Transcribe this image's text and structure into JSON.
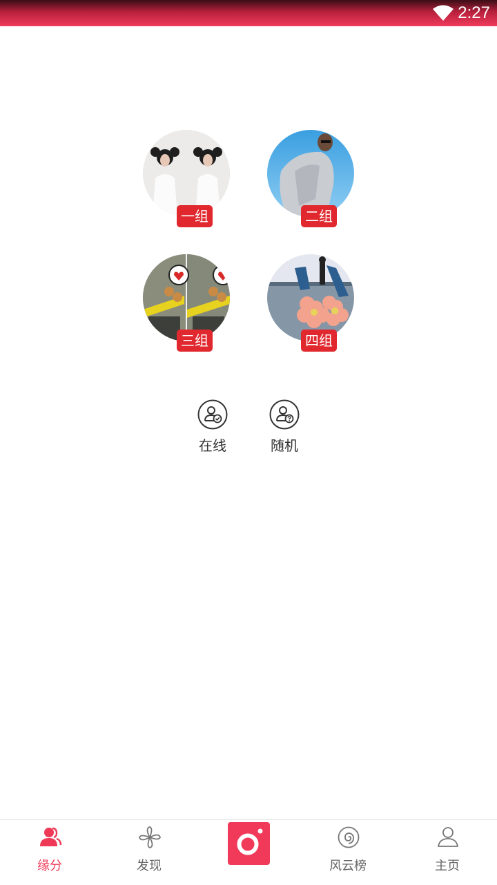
{
  "status_bar": {
    "time": "2:27"
  },
  "groups": [
    {
      "label": "一组"
    },
    {
      "label": "二组"
    },
    {
      "label": "三组"
    },
    {
      "label": "四组"
    }
  ],
  "actions": {
    "online": {
      "label": "在线",
      "icon": "user-check-icon"
    },
    "random": {
      "label": "随机",
      "icon": "user-question-icon"
    }
  },
  "tabbar": {
    "items": [
      {
        "label": "缘分",
        "icon": "users-icon",
        "active": true
      },
      {
        "label": "发现",
        "icon": "pinwheel-icon"
      },
      {
        "label": "",
        "icon": "camera-icon"
      },
      {
        "label": "风云榜",
        "icon": "spiral-icon"
      },
      {
        "label": "主页",
        "icon": "user-icon"
      }
    ]
  },
  "colors": {
    "accent": "#ee3a57",
    "badge": "#e0282e",
    "status_bar": "#f03a5c"
  }
}
